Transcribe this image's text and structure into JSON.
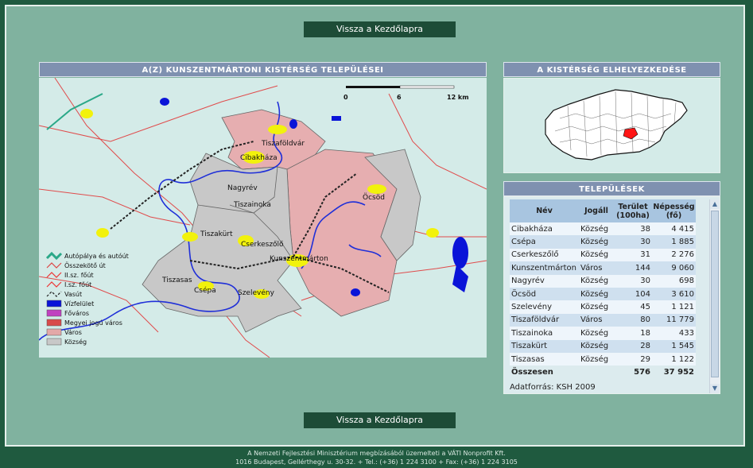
{
  "nav": {
    "home_label": "Vissza a Kezdőlapra"
  },
  "map_panel": {
    "title": "A(Z) KUNSZENTMÁRTONI KISTÉRSÉG TELEPÜLÉSEI",
    "scale": [
      "0",
      "6",
      "12 km"
    ],
    "settlements": [
      "Tiszaföldvár",
      "Cibakháza",
      "Nagyrév",
      "Tiszainoka",
      "Tiszakürt",
      "Cserkeszőlő",
      "Kunszentmárton",
      "Öcsöd",
      "Tiszasas",
      "Csépa",
      "Szelevény"
    ],
    "legend": [
      {
        "label": "Autópálya és autóút",
        "icon": "highway-icon",
        "color": "#2aa888"
      },
      {
        "label": "Összekötő út",
        "icon": "connecting-road-icon",
        "color": "#d44"
      },
      {
        "label": "II.sz. főút",
        "icon": "secondary-road-icon",
        "color": "#e33"
      },
      {
        "label": "I.sz. főút",
        "icon": "primary-road-icon",
        "color": "#e33"
      },
      {
        "label": "Vasút",
        "icon": "railway-icon",
        "color": "#222"
      },
      {
        "label": "Vízfelület",
        "icon": "water-icon",
        "color": "#0a14d8"
      },
      {
        "label": "Főváros",
        "icon": "capital-icon",
        "color": "#c040c0"
      },
      {
        "label": "Megyei jogú város",
        "icon": "county-city-icon",
        "color": "#d84a4a"
      },
      {
        "label": "Város",
        "icon": "town-icon",
        "color": "#e3a8a8"
      },
      {
        "label": "Község",
        "icon": "village-icon",
        "color": "#c8c8c8"
      }
    ]
  },
  "location_panel": {
    "title": "A KISTÉRSÉG ELHELYEZKEDÉSE"
  },
  "settlements_panel": {
    "title": "TELEPÜLÉSEK",
    "columns": [
      "Név",
      "Jogáll",
      "Terület (100ha)",
      "Népesség (fő)"
    ],
    "column_lines": [
      [
        "Név"
      ],
      [
        "Jogáll"
      ],
      [
        "Terület",
        "(100ha)"
      ],
      [
        "Népesség",
        "(fő)"
      ]
    ],
    "rows": [
      [
        "Cibakháza",
        "Község",
        "38",
        "4 415"
      ],
      [
        "Csépa",
        "Község",
        "30",
        "1 885"
      ],
      [
        "Cserkeszőlő",
        "Község",
        "31",
        "2 276"
      ],
      [
        "Kunszentmárton",
        "Város",
        "144",
        "9 060"
      ],
      [
        "Nagyrév",
        "Község",
        "30",
        "698"
      ],
      [
        "Öcsöd",
        "Község",
        "104",
        "3 610"
      ],
      [
        "Szelevény",
        "Község",
        "45",
        "1 121"
      ],
      [
        "Tiszaföldvár",
        "Város",
        "80",
        "11 779"
      ],
      [
        "Tiszainoka",
        "Község",
        "18",
        "433"
      ],
      [
        "Tiszakürt",
        "Község",
        "28",
        "1 545"
      ],
      [
        "Tiszasas",
        "Község",
        "29",
        "1 122"
      ]
    ],
    "total": [
      "Összesen",
      "",
      "576",
      "37 952"
    ],
    "source": "Adatforrás: KSH 2009"
  },
  "footer": {
    "line1": "A Nemzeti Fejlesztési Minisztérium megbízásából üzemelteti a VÁTI Nonprofit Kft.",
    "line2": "1016 Budapest, Gellérthegy u. 30-32. + Tel.: (+36) 1 224 3100 + Fax: (+36) 1 224 3105"
  }
}
